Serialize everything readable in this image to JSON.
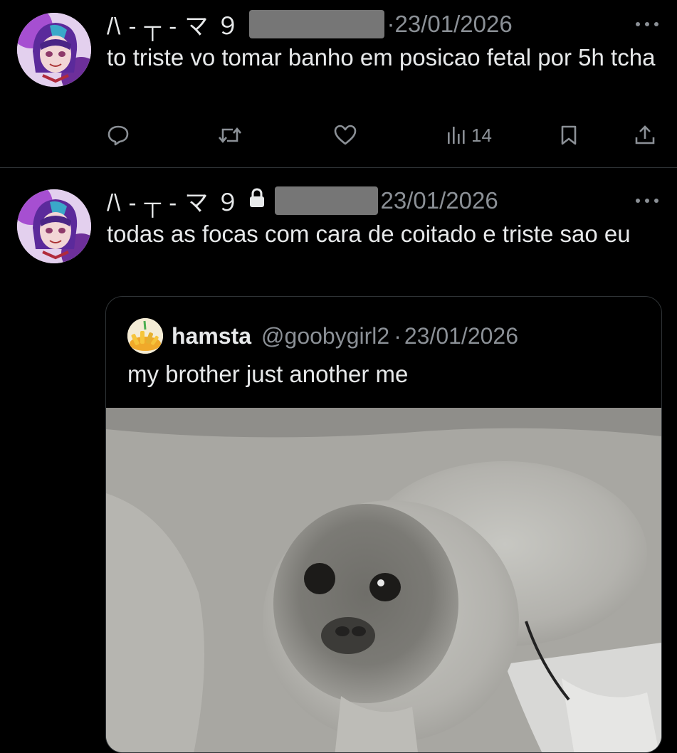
{
  "tweets": [
    {
      "display_name": "/\\ - ┬ - マ ９",
      "date": "23/01/2026",
      "text": "to triste vo tomar banho em posicao fetal por 5h tcha",
      "views": "14"
    },
    {
      "display_name": "/\\ - ┬ - マ ９",
      "date": "23/01/2026",
      "text": "todas as focas com cara de coitado e triste sao eu",
      "quote": {
        "name": "hamsta",
        "handle": "@goobygirl2",
        "separator": "·",
        "date": "23/01/2026",
        "text": "my brother just another me"
      }
    }
  ],
  "icons": {
    "reply": "reply-icon",
    "retweet": "retweet-icon",
    "like": "heart-icon",
    "views": "views-icon",
    "bookmark": "bookmark-icon",
    "share": "share-icon",
    "more": "more-icon",
    "lock": "lock-icon"
  },
  "colors": {
    "background": "#000000",
    "text": "#e7e9ea",
    "secondary": "#8b9096",
    "divider": "#2f3336"
  }
}
